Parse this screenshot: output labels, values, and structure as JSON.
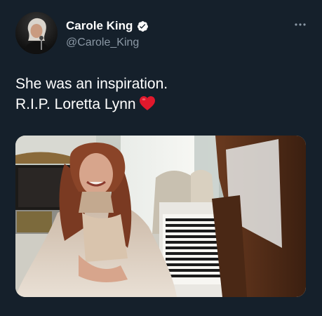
{
  "author": {
    "display_name": "Carole King",
    "handle": "@Carole_King",
    "verified": true,
    "avatar_icon": "profile-photo"
  },
  "tweet": {
    "lines": [
      "She was an inspiration.",
      "R.I.P. Loretta Lynn"
    ],
    "emoji": "red-heart",
    "media_icon": "photo-woman-at-piano"
  },
  "colors": {
    "background": "#15202b",
    "text_primary": "#ffffff",
    "text_secondary": "#8b98a5",
    "verified_badge": "#ffffff",
    "heart": "#e0182c"
  }
}
